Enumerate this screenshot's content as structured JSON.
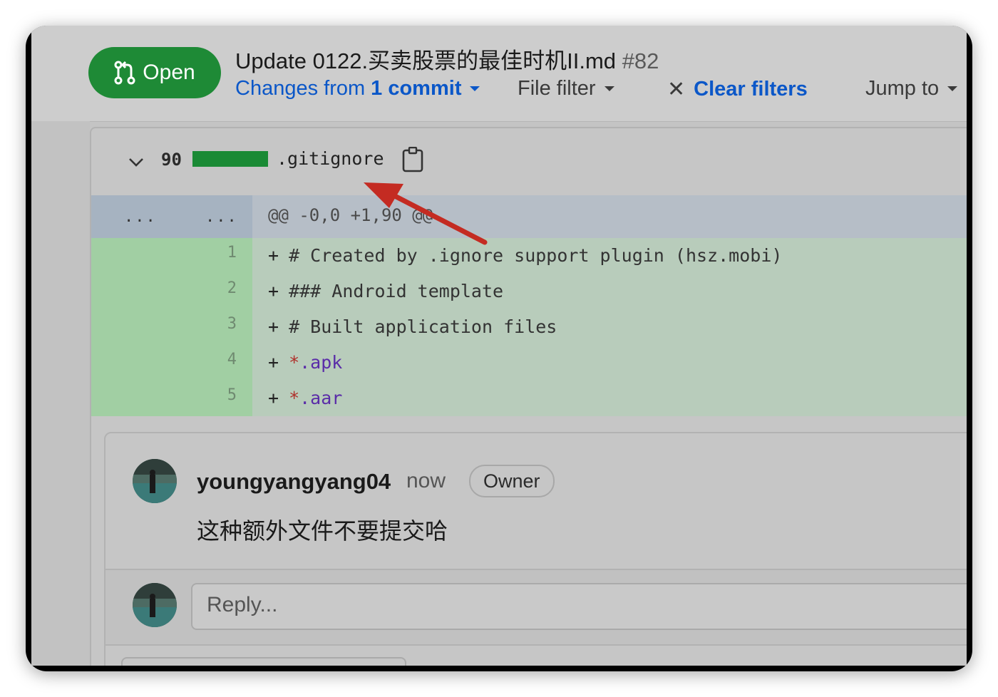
{
  "header": {
    "status_label": "Open",
    "pr_title": "Update 0122.买卖股票的最佳时机II.md",
    "pr_number": "#82",
    "changes_from_prefix": "Changes from",
    "changes_from_count": "1 commit",
    "file_filter_label": "File filter",
    "clear_filters_label": "Clear filters",
    "jump_to_label": "Jump to"
  },
  "file": {
    "diff_count": "90",
    "filename": ".gitignore",
    "hunk_left": "...",
    "hunk_right": "...",
    "hunk_header": "@@ -0,0 +1,90 @@"
  },
  "lines": [
    {
      "n": "1",
      "text": "# Created by .ignore support plugin (hsz.mobi)"
    },
    {
      "n": "2",
      "text": "### Android template"
    },
    {
      "n": "3",
      "text": "# Built application files"
    },
    {
      "n": "4",
      "star": "*",
      "ext": ".apk"
    },
    {
      "n": "5",
      "star": "*",
      "ext": ".aar"
    }
  ],
  "comment": {
    "author": "youngyangyang04",
    "time": "now",
    "role_badge": "Owner",
    "body": "这种额外文件不要提交哈",
    "reply_placeholder": "Reply..."
  },
  "colors": {
    "open_green": "#1e8a36",
    "link_blue": "#0b57c8",
    "annotation_arrow": "#c42b22"
  }
}
